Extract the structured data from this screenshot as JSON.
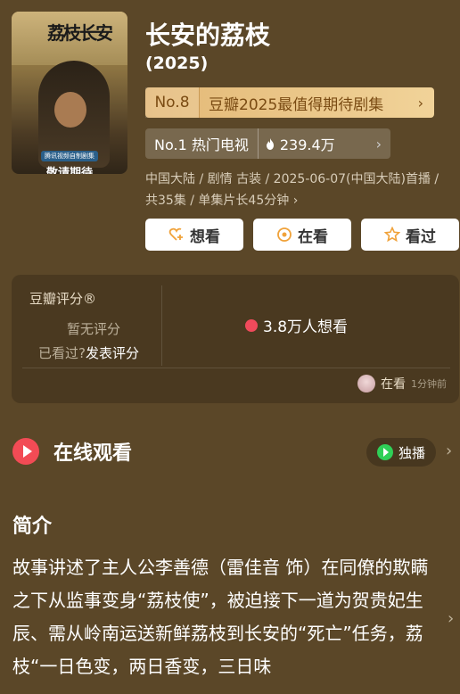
{
  "poster": {
    "title": "荔枝长安",
    "subtitle": "腾讯视频自制剧集",
    "badge": "敬请期待"
  },
  "header": {
    "title": "长安的荔枝",
    "year": "(2025)"
  },
  "rank": {
    "no": "No.8",
    "text": "豆瓣2025最值得期待剧集",
    "arrow": "›"
  },
  "hot": {
    "label": "No.1 热门电视",
    "value": "239.4万",
    "arrow": "›"
  },
  "meta": "中国大陆 / 剧情 古装 / 2025-06-07(中国大陆)首播 / 共35集 / 单集片长45分钟 ›",
  "actions": [
    {
      "label": "想看",
      "icon": "heart-plus-icon"
    },
    {
      "label": "在看",
      "icon": "target-icon"
    },
    {
      "label": "看过",
      "icon": "star-icon"
    }
  ],
  "rating": {
    "label": "豆瓣评分®",
    "none": "暂无评分",
    "seen_prefix": "已看过?",
    "seen_link": "发表评分",
    "want": "3.8万人想看",
    "recent_status": "在看",
    "recent_time": "1分钟前"
  },
  "watch": {
    "title": "在线观看",
    "exclusive": "独播"
  },
  "intro": {
    "title": "简介",
    "text": "故事讲述了主人公李善德（雷佳音 饰）在同僚的欺瞒之下从监事变身“荔枝使”，被迫接下一道为贺贵妃生辰、需从岭南运送新鲜荔枝到长安的“死亡”任务，荔枝“一日色变，两日香变，三日味"
  },
  "colors": {
    "background": "#5b4728",
    "rank_gold": "#e3b876",
    "accent_red": "#f24b55",
    "iqiyi_green": "#2fcf57"
  }
}
